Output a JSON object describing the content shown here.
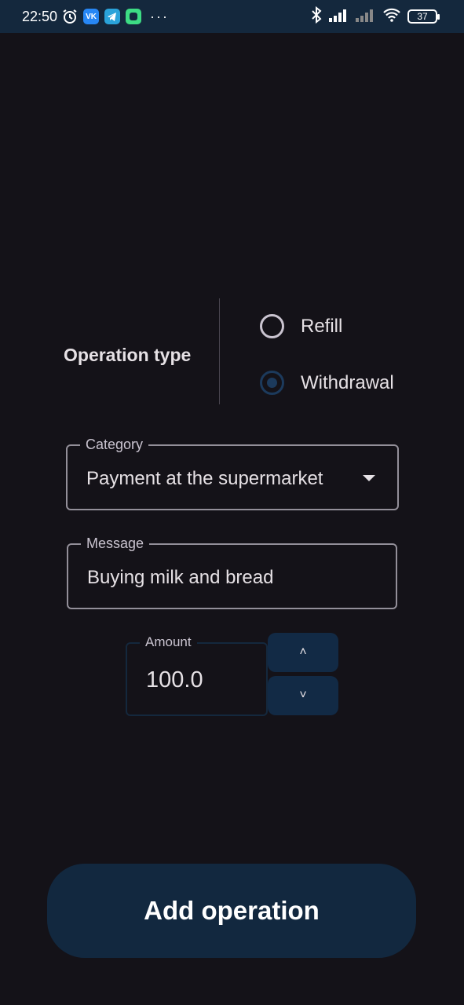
{
  "status_bar": {
    "time": "22:50",
    "battery": "37",
    "icons": [
      "alarm-icon",
      "vk-icon",
      "telegram-icon",
      "android-app-icon",
      "more-dots-icon",
      "bluetooth-icon",
      "signal-icon",
      "signal-off-icon",
      "wifi-icon",
      "battery-icon"
    ]
  },
  "operation_type": {
    "label": "Operation type",
    "options": [
      {
        "label": "Refill",
        "selected": false
      },
      {
        "label": "Withdrawal",
        "selected": true
      }
    ]
  },
  "category": {
    "label": "Category",
    "value": "Payment at the supermarket"
  },
  "message": {
    "label": "Message",
    "value": "Buying milk and bread"
  },
  "amount": {
    "label": "Amount",
    "value": "100.0",
    "up_glyph": "˄",
    "down_glyph": "˅"
  },
  "actions": {
    "add_label": "Add operation"
  },
  "colors": {
    "background": "#141218",
    "accent": "#12283f",
    "status_bar": "#14283d"
  }
}
